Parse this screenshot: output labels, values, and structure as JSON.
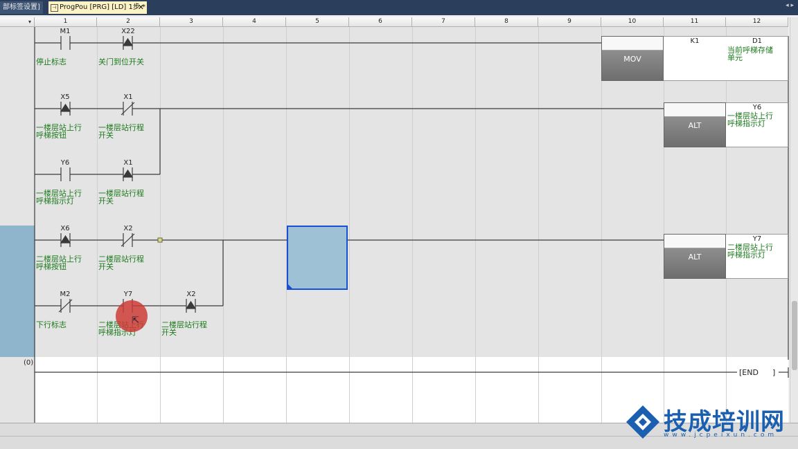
{
  "tabs": {
    "inactive": "部标签设置]",
    "active": "ProgPou [PRG] [LD] 1步 *",
    "close": "✕",
    "arrows": "◂ ▸"
  },
  "columns": [
    "1",
    "2",
    "3",
    "4",
    "5",
    "6",
    "7",
    "8",
    "9",
    "10",
    "11",
    "12"
  ],
  "corner_marker": "▾",
  "rungs": {
    "r1": {
      "c1_dev": "M1",
      "c1_lbl": "停止标志",
      "c2_dev": "X22",
      "c2_lbl": "关门到位开关",
      "instr": "MOV",
      "op1": "K1",
      "op2": "D1",
      "op2_lbl": "当前呼梯存储\n单元"
    },
    "r2": {
      "c1_dev": "X5",
      "c1_lbl": "一楼层站上行\n呼梯按钮",
      "c2_dev": "X1",
      "c2_lbl": "一楼层站行程\n开关",
      "p_dev": "Y6",
      "p_lbl": "一楼层站上行\n呼梯指示灯",
      "p2_dev": "X1",
      "p2_lbl": "一楼层站行程\n开关",
      "instr": "ALT",
      "out_dev": "Y6",
      "out_lbl": "一楼层站上行\n呼梯指示灯"
    },
    "r3": {
      "c1_dev": "X6",
      "c1_lbl": "二楼层站上行\n呼梯按钮",
      "c2_dev": "X2",
      "c2_lbl": "二楼层站行程\n开关",
      "p_dev": "M2",
      "p_lbl": "下行标志",
      "p2_dev": "Y7",
      "p2_lbl": "二楼层站上行\n呼梯指示灯",
      "p3_dev": "X2",
      "p3_lbl": "二楼层站行程\n开关",
      "instr": "ALT",
      "out_dev": "Y7",
      "out_lbl": "二楼层站上行\n呼梯指示灯"
    }
  },
  "end_label": "[END",
  "end_bracket": "]",
  "step_number": "(0)",
  "watermark": {
    "title": "技成培训网",
    "url": "www.jcpeixun.com"
  },
  "colors": {
    "wire": "#3a3a3a",
    "comment": "#1d7a1d",
    "cursor": "#1a4fd1",
    "selection": "#8fb5cc"
  }
}
